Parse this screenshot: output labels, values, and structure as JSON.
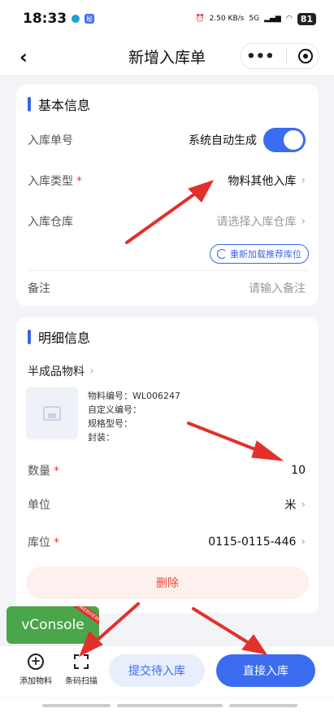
{
  "status_bar": {
    "time": "18:33",
    "app_badge": "秘",
    "speed": "2.50 KB/s",
    "network": "5G",
    "battery": "81"
  },
  "nav": {
    "title": "新增入库单",
    "more": "•••"
  },
  "basic": {
    "title": "基本信息",
    "order_no": {
      "label": "入库单号",
      "value": "系统自动生成",
      "auto_on": true
    },
    "type": {
      "label": "入库类型",
      "required": "*",
      "value": "物料其他入库"
    },
    "warehouse": {
      "label": "入库仓库",
      "placeholder": "请选择入库仓库"
    },
    "reload": "重新加载推荐库位",
    "remark": {
      "label": "备注",
      "placeholder": "请输入备注"
    }
  },
  "detail": {
    "title": "明细信息",
    "item_name": "半成品物料",
    "item_code": "物料编号：WL006247",
    "custom_code": "自定义编号：",
    "spec": "规格型号：",
    "package": "封装：",
    "qty": {
      "label": "数量",
      "required": "*",
      "value": "10"
    },
    "unit": {
      "label": "单位",
      "value": "米"
    },
    "location": {
      "label": "库位",
      "required": "*",
      "value": "0115-0115-446"
    },
    "delete": "删除"
  },
  "vconsole": {
    "label": "vConsole",
    "ribbon": "WEBVIEW"
  },
  "bottom": {
    "add_item": "添加物料",
    "scan": "条码扫描",
    "submit_pending": "提交待入库",
    "direct_in": "直接入库"
  },
  "colors": {
    "primary": "#3b6cf0",
    "danger": "#e84a3e",
    "console": "#4aa64a",
    "annotation_arrow": "#e2302b"
  }
}
